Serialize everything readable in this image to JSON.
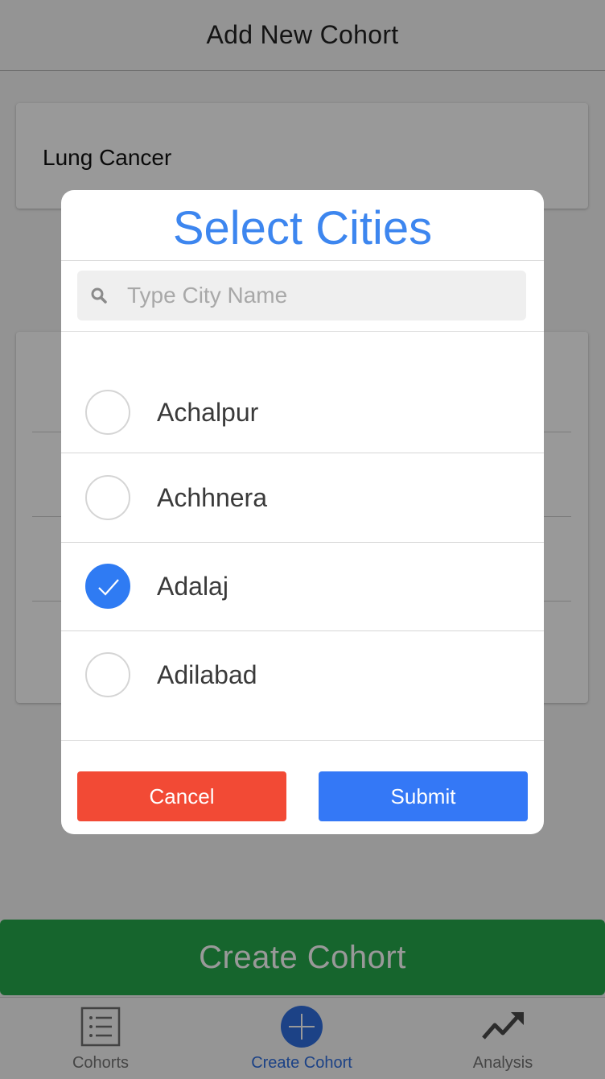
{
  "header": {
    "title": "Add New Cohort"
  },
  "form": {
    "cohort_name": "Lung Cancer"
  },
  "footer": {
    "create_label": "Create Cohort"
  },
  "tabs": [
    {
      "label": "Cohorts",
      "icon": "list-icon",
      "active": false
    },
    {
      "label": "Create Cohort",
      "icon": "plus-circle-icon",
      "active": true
    },
    {
      "label": "Analysis",
      "icon": "trend-icon",
      "active": false
    }
  ],
  "modal": {
    "title": "Select Cities",
    "search_placeholder": "Type City Name",
    "search_value": "",
    "cities": [
      {
        "name": "Achalpur",
        "selected": false
      },
      {
        "name": "Achhnera",
        "selected": false
      },
      {
        "name": "Adalaj",
        "selected": true
      },
      {
        "name": "Adilabad",
        "selected": false
      }
    ],
    "cancel_label": "Cancel",
    "submit_label": "Submit"
  },
  "colors": {
    "accent": "#3d86ef",
    "cancel": "#f24a35",
    "submit": "#3478f6",
    "create": "#26a84b"
  }
}
